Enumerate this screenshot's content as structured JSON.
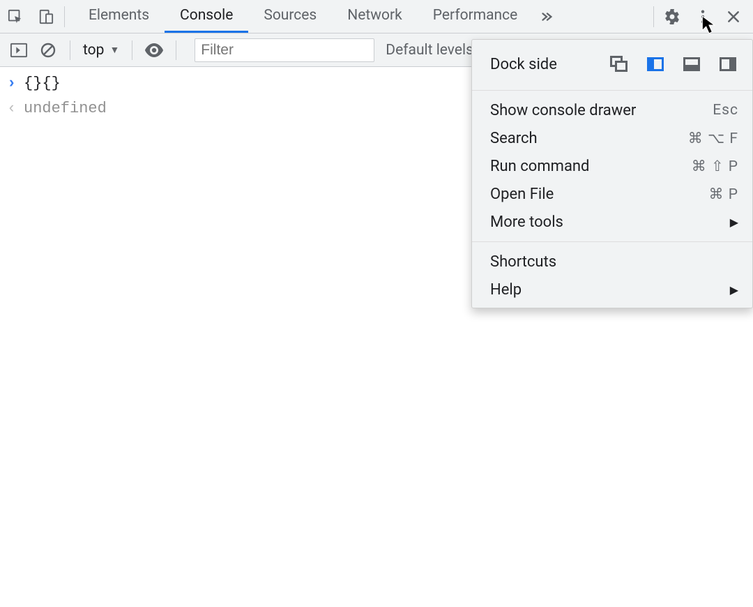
{
  "tabs": {
    "items": [
      "Elements",
      "Console",
      "Sources",
      "Network",
      "Performance"
    ],
    "active_index": 1
  },
  "subtoolbar": {
    "context": "top",
    "filter_placeholder": "Filter",
    "levels_label": "Default levels"
  },
  "console": {
    "input": "{}{}",
    "output": "undefined"
  },
  "menu": {
    "dock_label": "Dock side",
    "dock_active": "left",
    "items": [
      {
        "label": "Show console drawer",
        "shortcut": "Esc"
      },
      {
        "label": "Search",
        "shortcut": "⌘ ⌥ F"
      },
      {
        "label": "Run command",
        "shortcut": "⌘ ⇧ P"
      },
      {
        "label": "Open File",
        "shortcut": "⌘ P"
      },
      {
        "label": "More tools",
        "submenu": true
      }
    ],
    "footer": [
      {
        "label": "Shortcuts"
      },
      {
        "label": "Help",
        "submenu": true
      }
    ]
  }
}
